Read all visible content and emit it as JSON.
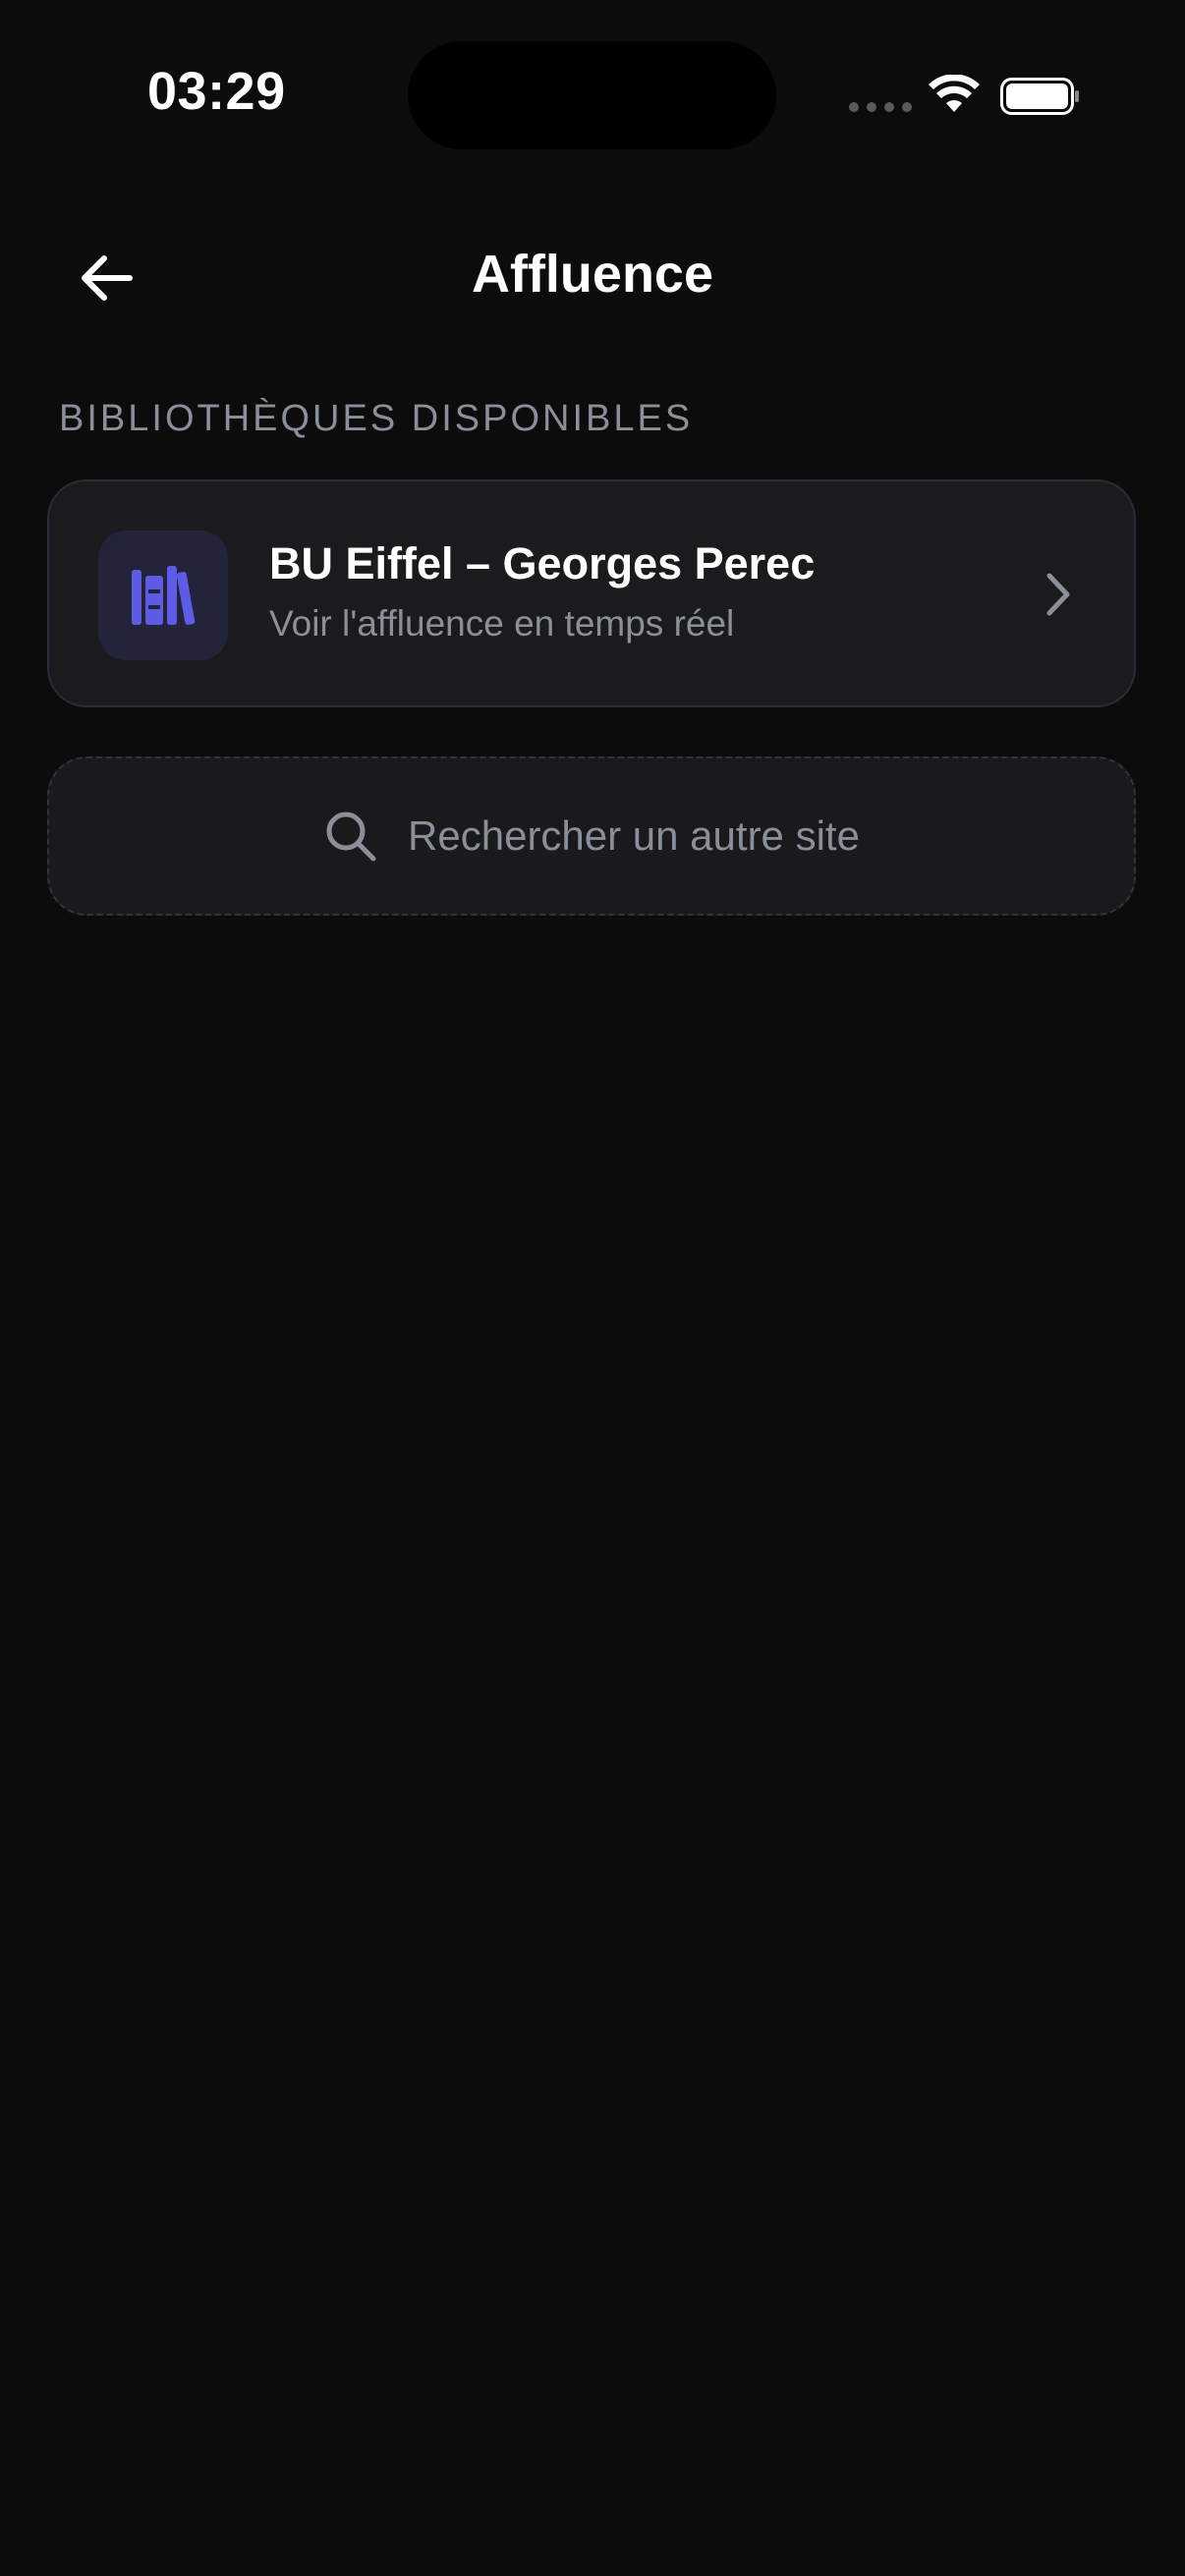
{
  "status_bar": {
    "time": "03:29"
  },
  "header": {
    "title": "Affluence",
    "back_icon": "arrow-left-icon"
  },
  "section": {
    "label": "BIBLIOTHÈQUES DISPONIBLES"
  },
  "libraries": [
    {
      "name": "BU Eiffel – Georges Perec",
      "subtitle": "Voir l'affluence en temps réel",
      "icon": "books-icon",
      "icon_color": "#5e5ce6"
    }
  ],
  "search": {
    "label": "Rechercher un autre site",
    "icon": "search-icon"
  },
  "colors": {
    "background": "#0c0c0d",
    "card": "#1b1b1d",
    "muted_text": "#8a8f99",
    "accent": "#5e5ce6"
  }
}
